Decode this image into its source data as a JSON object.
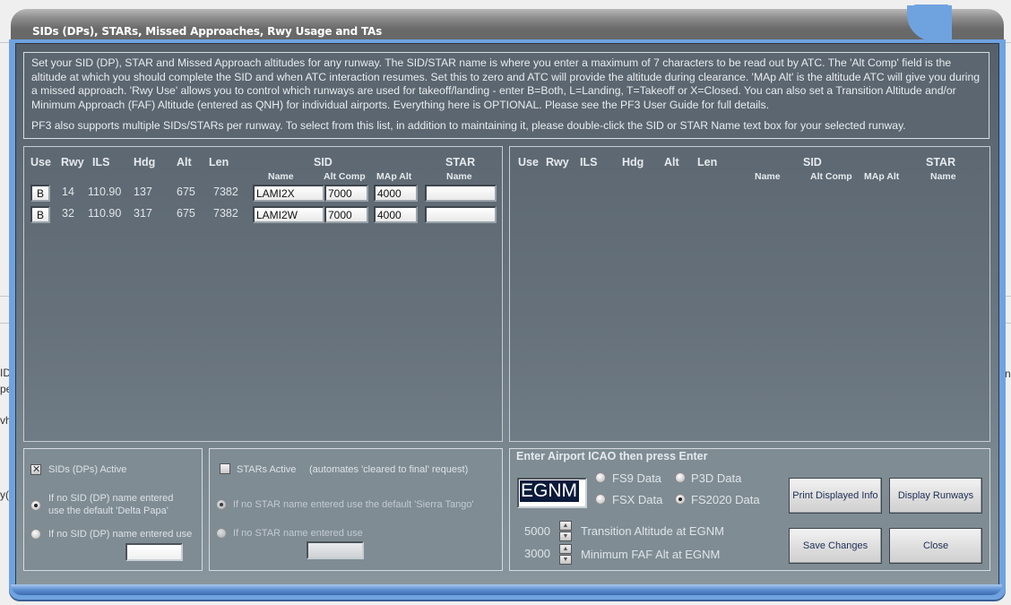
{
  "window": {
    "title": "SIDs (DPs), STARs, Missed Approaches, Rwy Usage and TAs"
  },
  "background_fragments": [
    "ID",
    "pe",
    "vh",
    "y("
  ],
  "background_fragments_right": [
    "n"
  ],
  "info": {
    "paragraph1": "Set your SID (DP), STAR and Missed Approach altitudes for any runway. The SID/STAR name is where you enter a maximum of 7 characters to be read out by ATC. The 'Alt Comp' field is the altitude at which you should complete the SID and when ATC interaction resumes. Set this to zero and ATC will provide the altitude during clearance. 'MAp Alt' is the altitude ATC will give you during a missed approach. 'Rwy Use' allows you to control which runways are used for takeoff/landing - enter B=Both, L=Landing, T=Takeoff or X=Closed.  You can also set a Transition Altitude and/or Minimum Approach (FAF) Altitude (entered as QNH) for individual airports. Everything here is OPTIONAL. Please see the PF3 User Guide for full details.",
    "paragraph2": "PF3 also supports multiple SIDs/STARs per runway. To select from this list, in addition to maintaining it, please double-click the SID or STAR Name text box for your selected runway."
  },
  "grid_headers": {
    "use": "Use",
    "rwy": "Rwy",
    "ils": "ILS",
    "hdg": "Hdg",
    "alt": "Alt",
    "len": "Len",
    "sid": "SID",
    "star": "STAR",
    "sid_name": "Name",
    "sid_alt_comp": "Alt Comp",
    "sid_map_alt": "MAp Alt",
    "star_name": "Name"
  },
  "runways_left": [
    {
      "use": "B",
      "rwy": "14",
      "ils": "110.90",
      "hdg": "137",
      "alt": "675",
      "len": "7382",
      "sid_name": "LAMI2X",
      "alt_comp": "7000",
      "map_alt": "4000",
      "star_name": ""
    },
    {
      "use": "B",
      "rwy": "32",
      "ils": "110.90",
      "hdg": "317",
      "alt": "675",
      "len": "7382",
      "sid_name": "LAMI2W",
      "alt_comp": "7000",
      "map_alt": "4000",
      "star_name": ""
    }
  ],
  "runways_right": [],
  "sid_options": {
    "active_label": "SIDs (DPs) Active",
    "active_checked": true,
    "default_option_label": "If no SID (DP) name entered use the default 'Delta Papa'",
    "default_option_line1": "If no SID (DP) name entered",
    "default_option_line2": "use the default 'Delta Papa'",
    "custom_option_label": "If no SID (DP) name entered use",
    "selected": "default",
    "custom_value": ""
  },
  "star_options": {
    "active_label": "STARs Active",
    "active_note": "(automates 'cleared to final' request)",
    "active_checked": false,
    "default_option_label": "If no STAR name entered use the default 'Sierra Tango'",
    "custom_option_label": "If no STAR name entered use",
    "selected": "default",
    "custom_value": ""
  },
  "airport": {
    "section_title": "Enter Airport ICAO then press Enter",
    "icao": "EGNM",
    "data_sources": [
      {
        "label": "FS9 Data",
        "selected": false
      },
      {
        "label": "P3D Data",
        "selected": false
      },
      {
        "label": "FSX Data",
        "selected": false
      },
      {
        "label": "FS2020 Data",
        "selected": true
      }
    ],
    "transition_altitude": "5000",
    "transition_label": "Transition Altitude at EGNM",
    "min_faf_alt": "3000",
    "min_faf_label": "Minimum FAF Alt at EGNM"
  },
  "buttons": {
    "print": "Print Displayed Info",
    "display_runways": "Display Runways",
    "save": "Save Changes",
    "close": "Close"
  },
  "icons": {
    "spin_up": "▲",
    "spin_down": "▼"
  }
}
